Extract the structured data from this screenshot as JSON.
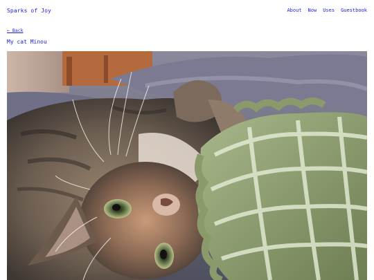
{
  "header": {
    "site_title": "Sparks of Joy",
    "nav": [
      {
        "label": "About"
      },
      {
        "label": "Now"
      },
      {
        "label": "Uses"
      },
      {
        "label": "Guestbook"
      }
    ]
  },
  "post": {
    "back_label": "← Back",
    "title": "My cat Minou"
  },
  "colors": {
    "link": "#1c1cd8",
    "background": "#ffffff"
  }
}
